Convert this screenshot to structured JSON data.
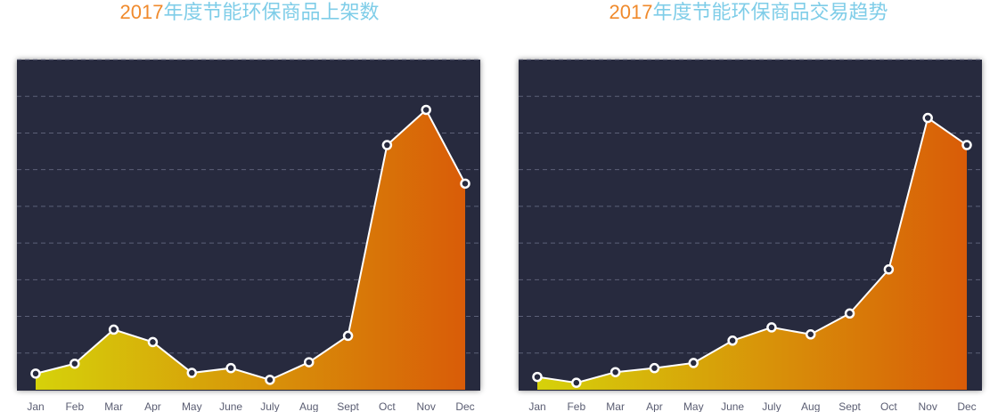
{
  "colors": {
    "background": "#272a3e",
    "grid": "#6a6e86",
    "line": "#ffffff",
    "gradient_start": "#d6d20a",
    "gradient_end": "#d95c08",
    "title_year": "#f08a2c",
    "title_text": "#7fcde8"
  },
  "charts": {
    "left": {
      "title_year": "2017",
      "title_text": "年度节能环保商品上架数"
    },
    "right": {
      "title_year": "2017",
      "title_text": "年度节能环保商品交易趋势"
    }
  },
  "chart_data": [
    {
      "type": "area",
      "title": "2017年度节能环保商品上架数",
      "xlabel": "",
      "ylabel": "",
      "categories": [
        "Jan",
        "Feb",
        "Mar",
        "Apr",
        "May",
        "June",
        "July",
        "Aug",
        "Sept",
        "Oct",
        "Nov",
        "Dec"
      ],
      "values": [
        4.4,
        7.1,
        16.4,
        13.0,
        4.6,
        5.9,
        2.7,
        7.5,
        14.7,
        66.7,
        76.3,
        56.2
      ],
      "ylim": [
        0,
        90
      ],
      "grid": true,
      "legend": "none"
    },
    {
      "type": "area",
      "title": "2017年度节能环保商品交易趋势",
      "xlabel": "",
      "ylabel": "",
      "categories": [
        "Jan",
        "Feb",
        "Mar",
        "Apr",
        "May",
        "June",
        "July",
        "Aug",
        "Sept",
        "Oct",
        "Nov",
        "Dec"
      ],
      "values": [
        3.5,
        1.9,
        4.8,
        5.9,
        7.3,
        13.4,
        17.0,
        15.1,
        20.8,
        32.8,
        74.1,
        66.7
      ],
      "ylim": [
        0,
        90
      ],
      "grid": true,
      "legend": "none"
    }
  ]
}
